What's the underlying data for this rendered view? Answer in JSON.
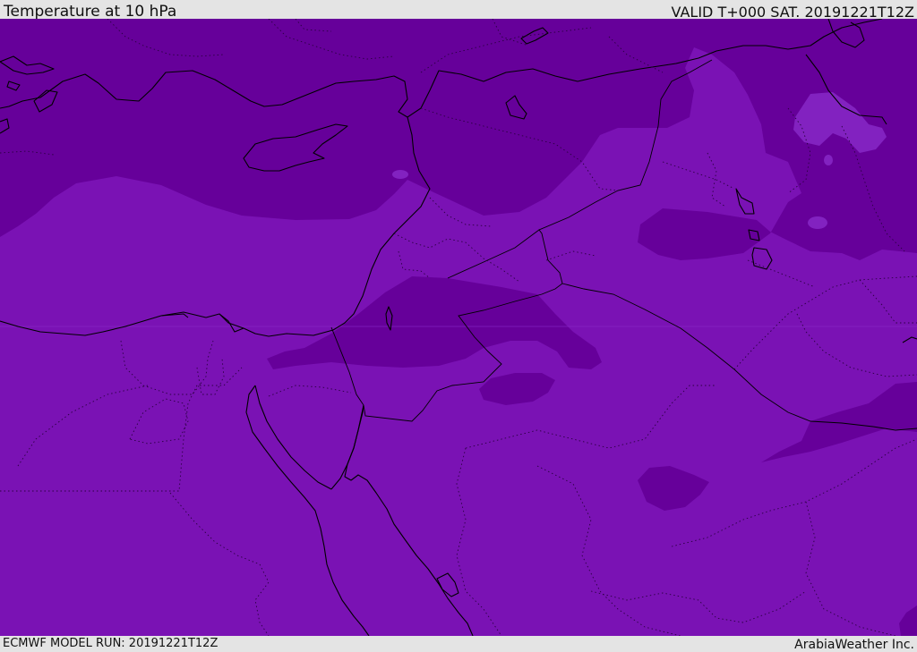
{
  "header": {
    "title": "Temperature at 10 hPa",
    "valid": "VALID T+000 SAT. 20191221T12Z"
  },
  "footer": {
    "model_run": "ECMWF MODEL RUN: 20191221T12Z",
    "credit": "ArabiaWeather Inc."
  },
  "colors": {
    "band_warm": "#7a12b4",
    "band_cold": "#66009a",
    "band_light": "#8222c0",
    "coastline": "#000000",
    "border_dotted": "#2a0040",
    "chrome": "#e4e4e4"
  },
  "map": {
    "field": "temperature",
    "level": "10 hPa"
  }
}
